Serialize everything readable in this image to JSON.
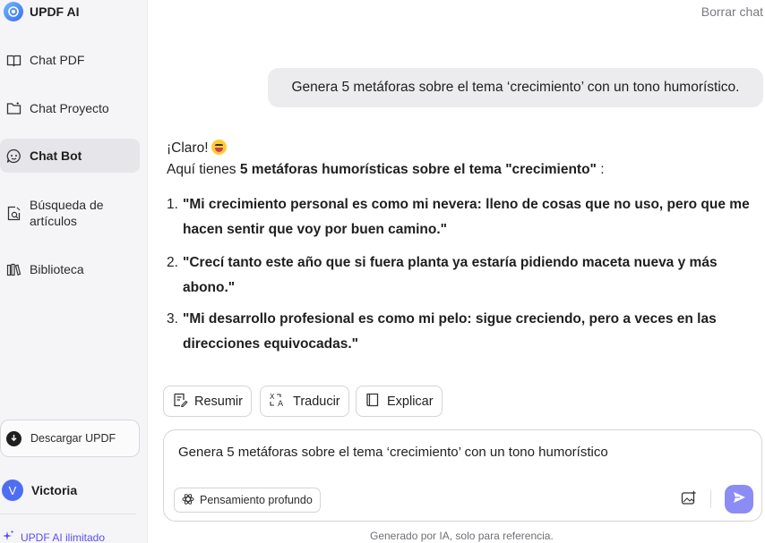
{
  "brand": {
    "name": "UPDF AI"
  },
  "sidebar": {
    "items": [
      {
        "label": "Chat PDF",
        "icon": "book-open-icon"
      },
      {
        "label": "Chat Proyecto",
        "icon": "folder-icon"
      },
      {
        "label": "Chat Bot",
        "icon": "chatbot-icon",
        "active": true
      },
      {
        "label_line1": "Búsqueda de",
        "label_line2": "artículos",
        "icon": "search-document-icon"
      },
      {
        "label": "Biblioteca",
        "icon": "library-icon"
      }
    ],
    "download_label": "Descargar UPDF",
    "user": {
      "initial": "V",
      "name": "Victoria"
    },
    "unlimited_label": "UPDF AI ilimitado"
  },
  "header": {
    "clear_chat": "Borrar chat"
  },
  "conversation": {
    "user_message": "Genera 5 metáforas sobre el tema ‘crecimiento’ con un tono humorístico.",
    "reply": {
      "greeting": "¡Claro!",
      "intro_prefix": "Aquí tienes ",
      "intro_bold": "5 metáforas humorísticas sobre el tema \"crecimiento\"",
      "intro_suffix": " :",
      "items": [
        {
          "num": "1.",
          "line1": "\"Mi crecimiento personal es como mi nevera: lleno de cosas que no uso, pero que me",
          "line2": "hacen sentir que voy por buen camino.\""
        },
        {
          "num": "2.",
          "line1": "\"Crecí tanto este año que si fuera planta ya estaría pidiendo maceta nueva y más",
          "line2": "abono.\""
        },
        {
          "num": "3.",
          "line1": "\"Mi desarrollo profesional es como mi pelo: sigue creciendo, pero a veces en las",
          "line2": "direcciones equivocadas.\""
        }
      ]
    }
  },
  "actions": {
    "summarize": "Resumir",
    "translate": "Traducir",
    "explain": "Explicar"
  },
  "composer": {
    "input_value": "Genera 5 metáforas sobre el tema ‘crecimiento’ con un tono humorístico",
    "deep_think": "Pensamiento profundo"
  },
  "footer": {
    "note": "Generado por IA, solo para referencia."
  },
  "colors": {
    "accent": "#5b4ef0",
    "send": "#8c8cf5",
    "avatar": "#4e6ef2"
  }
}
